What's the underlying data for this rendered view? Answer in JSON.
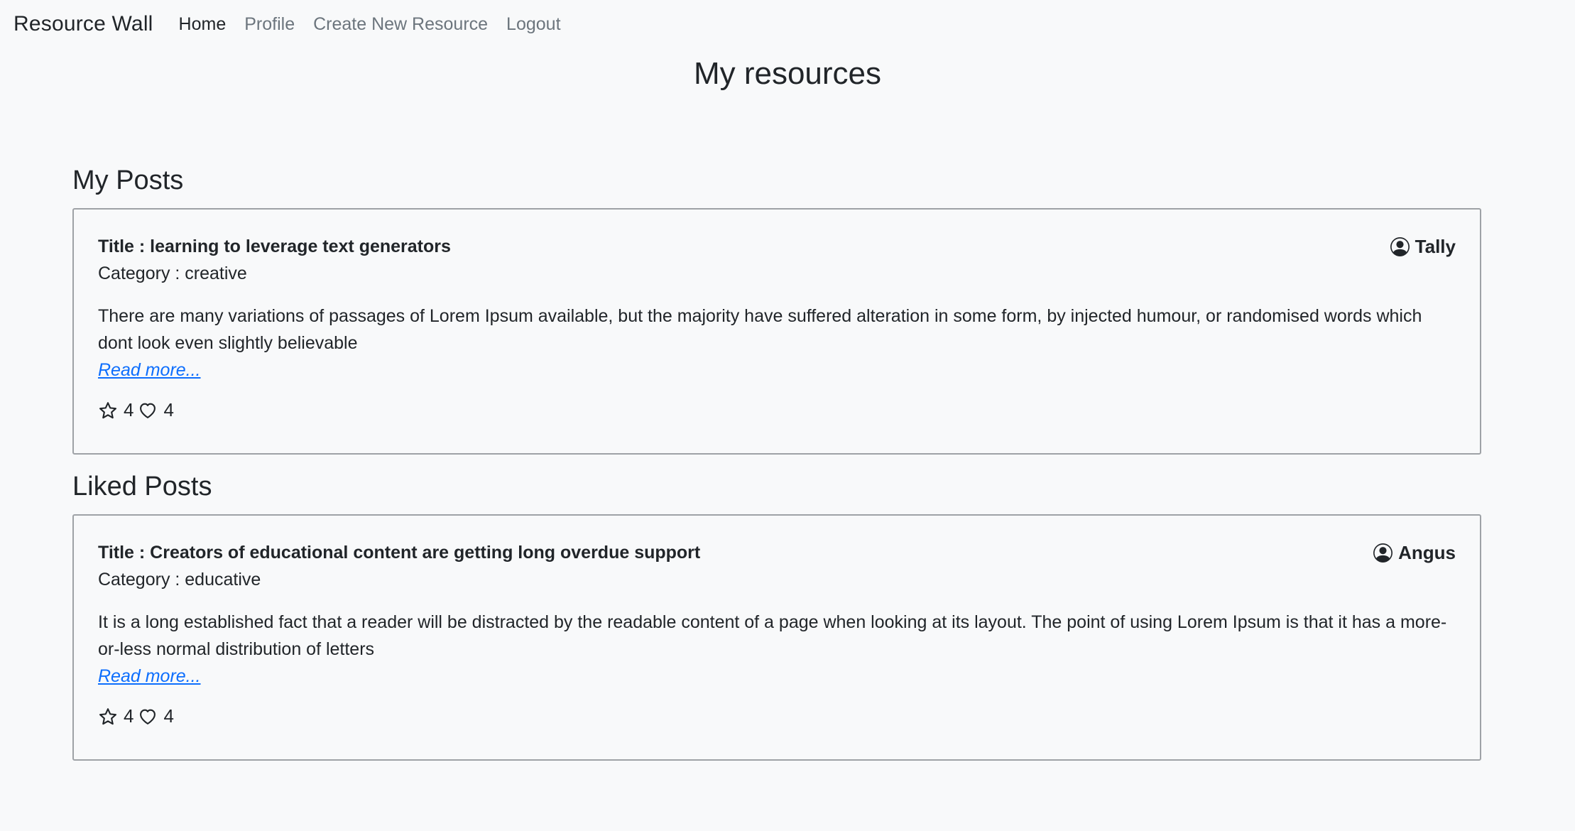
{
  "nav": {
    "brand": "Resource Wall",
    "links": [
      "Home",
      "Profile",
      "Create New Resource",
      "Logout"
    ]
  },
  "page_title": "My resources",
  "my_posts": {
    "heading": "My Posts",
    "post": {
      "title": "Title : learning to leverage text generators",
      "author": "Tally",
      "category": "Category : creative",
      "description": "There are many variations of passages of Lorem Ipsum available, but the majority have suffered alteration in some form, by injected humour, or randomised words which dont look even slightly believable",
      "read_more": "Read more...",
      "rating": "4",
      "likes": "4"
    }
  },
  "liked_posts": {
    "heading": "Liked Posts",
    "post": {
      "title": "Title : Creators of educational content are getting long overdue support",
      "author": "Angus",
      "category": "Category : educative",
      "description": "It is a long established fact that a reader will be distracted by the readable content of a page when looking at its layout. The point of using Lorem Ipsum is that it has a more-or-less normal distribution of letters",
      "read_more": "Read more...",
      "rating": "4",
      "likes": "4"
    }
  },
  "colors": {
    "background": "#f8f9fa",
    "text": "#212529",
    "muted": "#6c757d",
    "link": "#0d6efd",
    "card_border": "#9ea2a6"
  },
  "icons": [
    "user-circle-icon",
    "star-icon",
    "heart-icon"
  ]
}
